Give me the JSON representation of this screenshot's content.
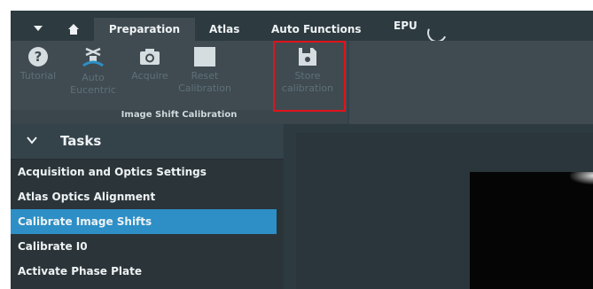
{
  "tabs": {
    "preparation": "Preparation",
    "atlas": "Atlas",
    "auto_functions": "Auto Functions",
    "epu": "EPU"
  },
  "ribbon": {
    "buttons": [
      {
        "label_line1": "Tutorial",
        "label_line2": "",
        "icon": "help-icon"
      },
      {
        "label_line1": "Auto",
        "label_line2": "Eucentric",
        "icon": "eucentric-icon"
      },
      {
        "label_line1": "Acquire",
        "label_line2": "",
        "icon": "camera-icon"
      },
      {
        "label_line1": "Reset",
        "label_line2": "Calibration",
        "icon": "reset-square-icon"
      },
      {
        "label_line1": "Store",
        "label_line2": "calibration",
        "icon": "save-icon"
      }
    ],
    "group_label": "Image Shift Calibration"
  },
  "tasks": {
    "title": "Tasks",
    "items": [
      {
        "label": "Acquisition and Optics Settings"
      },
      {
        "label": "Atlas Optics Alignment"
      },
      {
        "label": "Calibrate Image Shifts"
      },
      {
        "label": "Calibrate I0"
      },
      {
        "label": "Activate Phase Plate"
      }
    ]
  },
  "colors": {
    "selected": "#2d8fc6",
    "highlight": "#e1131b",
    "background": "#2b3439"
  }
}
